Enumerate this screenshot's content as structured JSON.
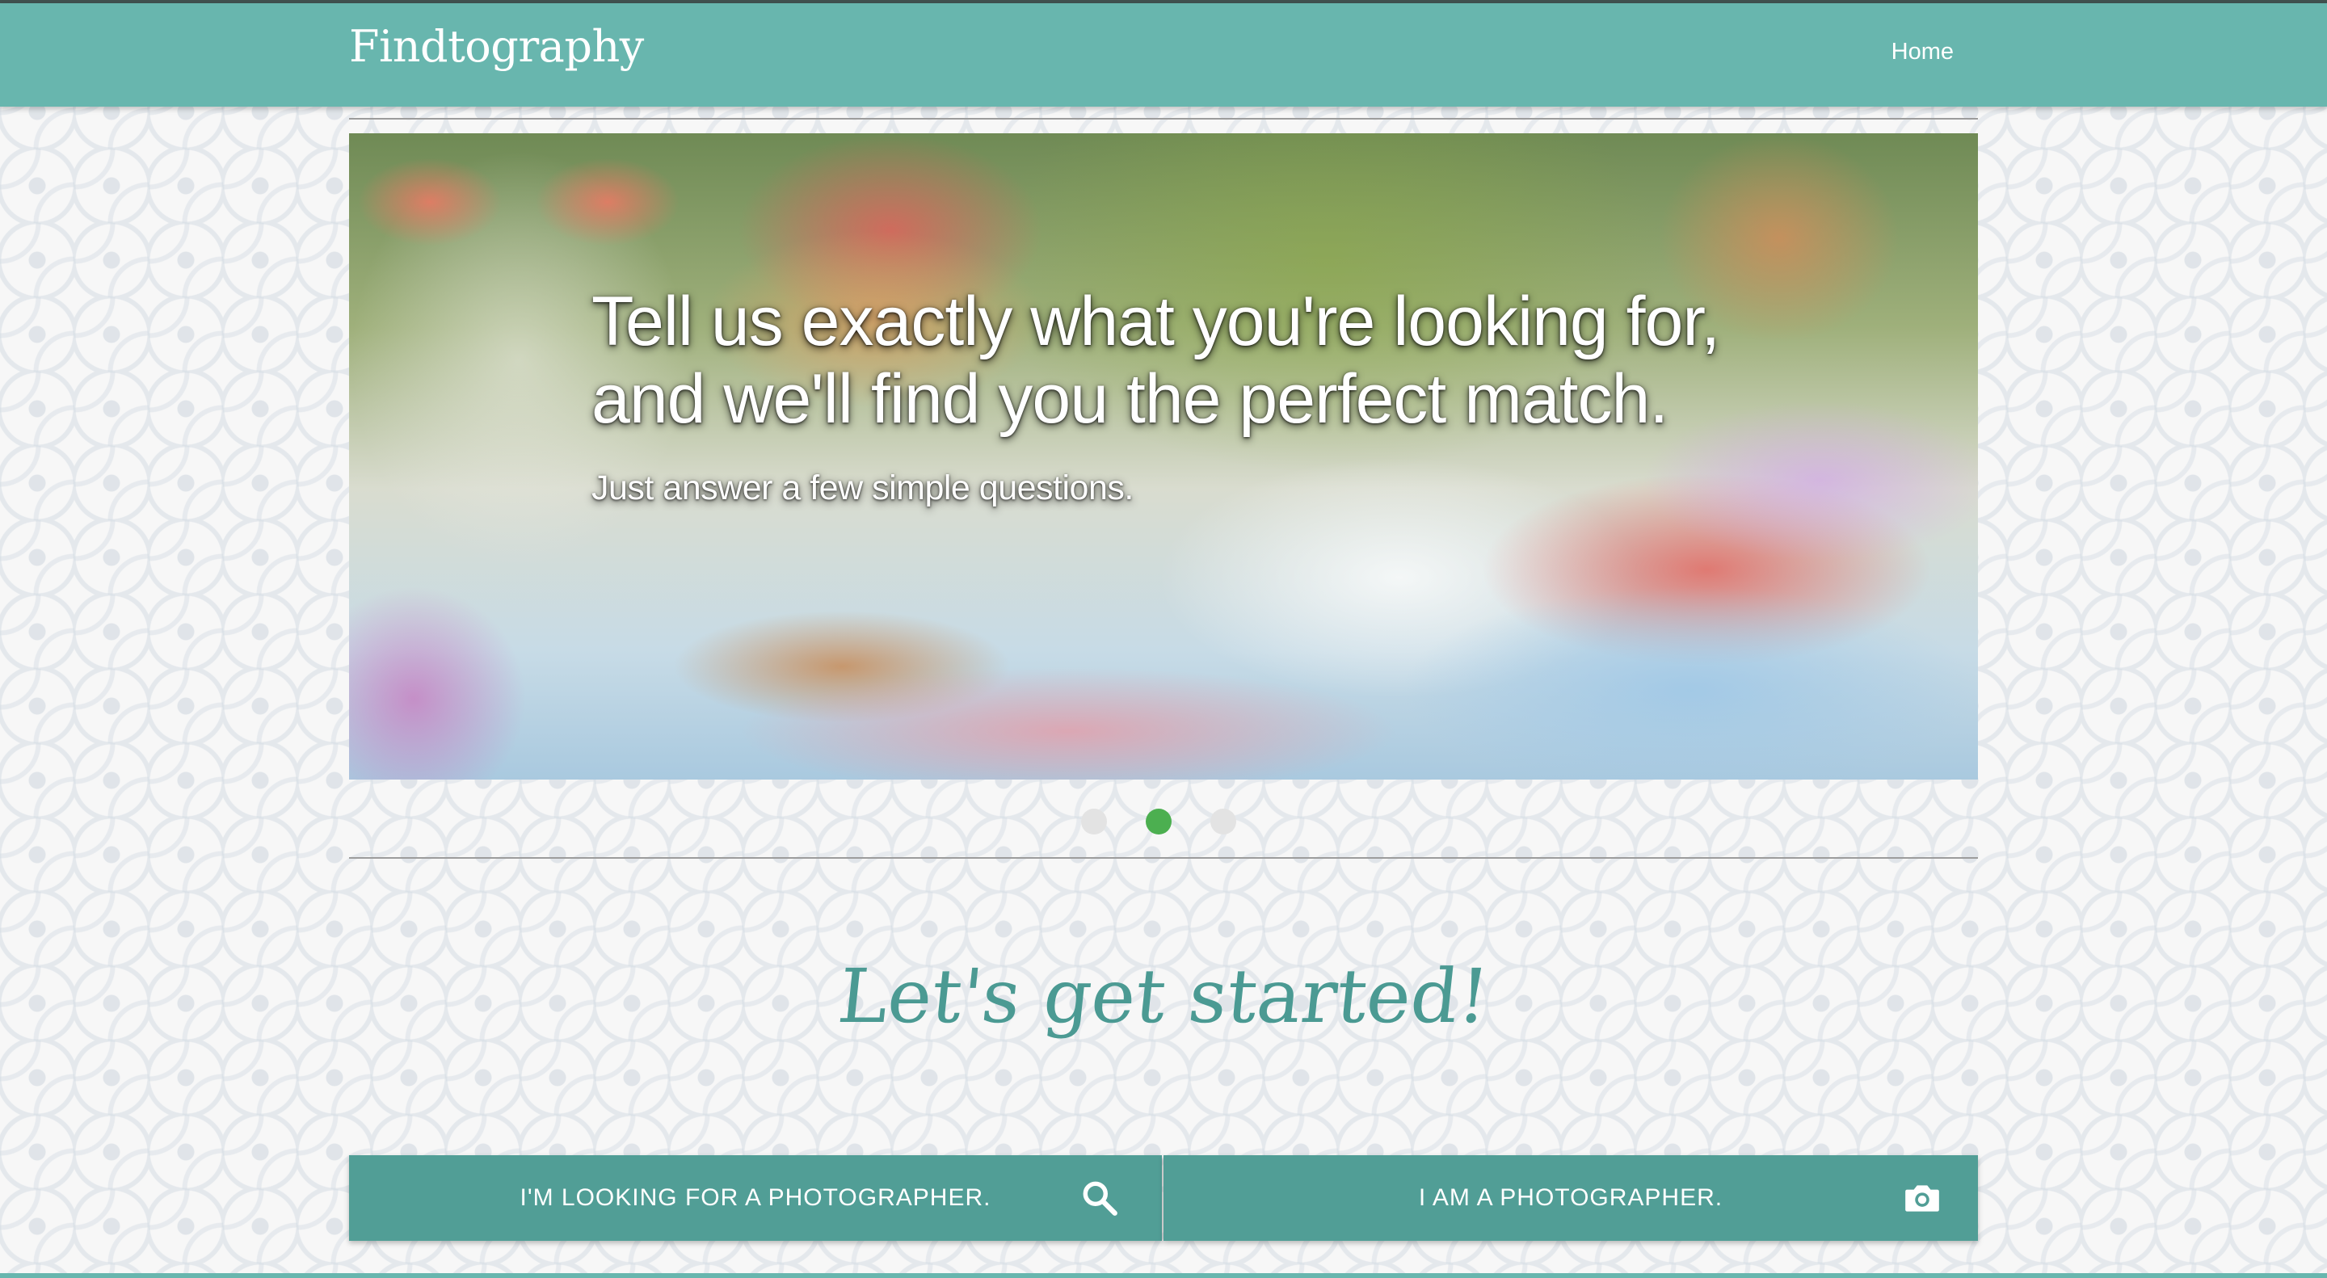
{
  "brand": "Findtography",
  "nav": {
    "home": "Home"
  },
  "hero": {
    "title_line1": "Tell us exactly what you're looking for,",
    "title_line2": "and we'll find you the perfect match.",
    "subtitle": "Just answer a few simple questions.",
    "image_icon": "photo-of-catered-dessert-table"
  },
  "carousel": {
    "slides": 3,
    "active_index": 1
  },
  "cta": {
    "heading": "Let's get started!",
    "client_button": "I'M LOOKING FOR A PHOTOGRAPHER.",
    "client_icon": "search-icon",
    "photographer_button": "I AM A PHOTOGRAPHER.",
    "photographer_icon": "camera-icon"
  },
  "colors": {
    "navbar": "#68b6ae",
    "button": "#519e96",
    "heading": "#4b9a93",
    "active_dot": "#4caf50"
  }
}
